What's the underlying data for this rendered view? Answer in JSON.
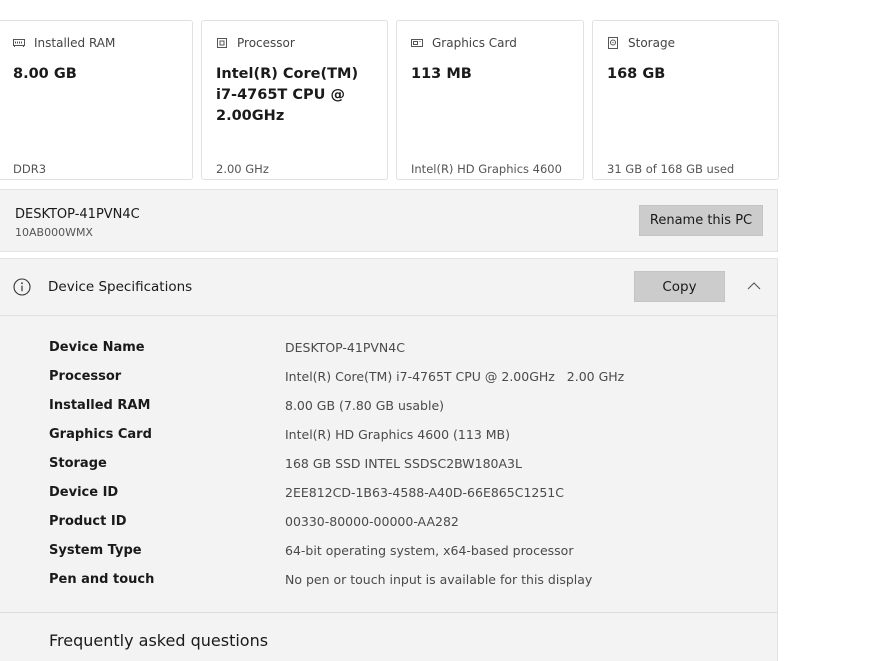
{
  "cards": [
    {
      "title": "Installed RAM",
      "value": "8.00 GB",
      "sub": "DDR3",
      "icon": "ram-icon"
    },
    {
      "title": "Processor",
      "value": "Intel(R) Core(TM) i7-4765T CPU @ 2.00GHz",
      "sub": "2.00 GHz",
      "icon": "processor-icon"
    },
    {
      "title": "Graphics Card",
      "value": "113 MB",
      "sub": "Intel(R) HD Graphics 4600",
      "icon": "graphics-card-icon"
    },
    {
      "title": "Storage",
      "value": "168 GB",
      "sub": "31 GB of 168 GB used",
      "icon": "storage-icon"
    }
  ],
  "pc": {
    "name": "DESKTOP-41PVN4C",
    "model": "10AB000WMX",
    "rename_label": "Rename this PC"
  },
  "specs": {
    "title": "Device Specifications",
    "copy_label": "Copy",
    "rows": [
      {
        "label": "Device Name",
        "value": "DESKTOP-41PVN4C"
      },
      {
        "label": "Processor",
        "value": "Intel(R) Core(TM) i7-4765T CPU @ 2.00GHz   2.00 GHz"
      },
      {
        "label": "Installed RAM",
        "value": "8.00 GB (7.80 GB usable)"
      },
      {
        "label": "Graphics Card",
        "value": "Intel(R) HD Graphics 4600 (113 MB)"
      },
      {
        "label": "Storage",
        "value": "168 GB SSD INTEL SSDSC2BW180A3L"
      },
      {
        "label": "Device ID",
        "value": "2EE812CD-1B63-4588-A40D-66E865C1251C"
      },
      {
        "label": "Product ID",
        "value": "00330-80000-00000-AA282"
      },
      {
        "label": "System Type",
        "value": "64-bit operating system, x64-based processor"
      },
      {
        "label": "Pen and touch",
        "value": "No pen or touch input is available for this display"
      }
    ]
  },
  "faq": {
    "title": "Frequently asked questions"
  }
}
